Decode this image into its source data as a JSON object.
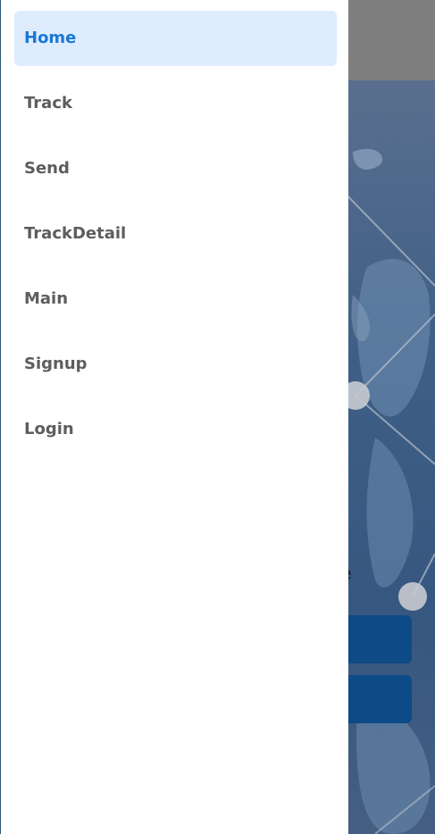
{
  "drawer": {
    "items": [
      {
        "label": "Home",
        "active": true
      },
      {
        "label": "Track",
        "active": false
      },
      {
        "label": "Send",
        "active": false
      },
      {
        "label": "TrackDetail",
        "active": false
      },
      {
        "label": "Main",
        "active": false
      },
      {
        "label": "Signup",
        "active": false
      },
      {
        "label": "Login",
        "active": false
      }
    ]
  },
  "background": {
    "phone_text": "one",
    "buttons": [
      "",
      ""
    ]
  },
  "colors": {
    "active_bg": "#deecfd",
    "active_text": "#1a78d6",
    "inactive_text": "#5d5d5d",
    "button_bg": "#0d4a86",
    "header_bg": "#7f7f7f"
  }
}
